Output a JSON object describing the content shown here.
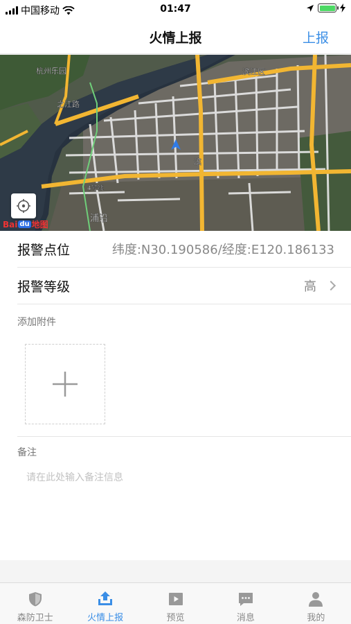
{
  "status_bar": {
    "carrier": "中国移动",
    "time": "01:47"
  },
  "header": {
    "title": "火情上报",
    "action_label": "上报"
  },
  "map": {
    "district_labels": [
      "杭州乐园",
      "滨江区",
      "之江路",
      "4号线",
      "浦沿",
      "滨"
    ],
    "logo_bai": "Bai",
    "logo_du": "du",
    "logo_map": "地图"
  },
  "form": {
    "location_label": "报警点位",
    "location_value": "纬度:N30.190586/经度:E120.186133",
    "level_label": "报警等级",
    "level_value": "高",
    "attachment_label": "添加附件",
    "remarks_label": "备注",
    "remarks_placeholder": "请在此处输入备注信息"
  },
  "tabs": [
    {
      "label": "森防卫士",
      "icon": "shield-icon",
      "active": false
    },
    {
      "label": "火情上报",
      "icon": "upload-icon",
      "active": true
    },
    {
      "label": "预览",
      "icon": "play-icon",
      "active": false
    },
    {
      "label": "消息",
      "icon": "message-icon",
      "active": false
    },
    {
      "label": "我的",
      "icon": "person-icon",
      "active": false
    }
  ],
  "colors": {
    "accent": "#3a8ee6",
    "inactive": "#888888"
  }
}
